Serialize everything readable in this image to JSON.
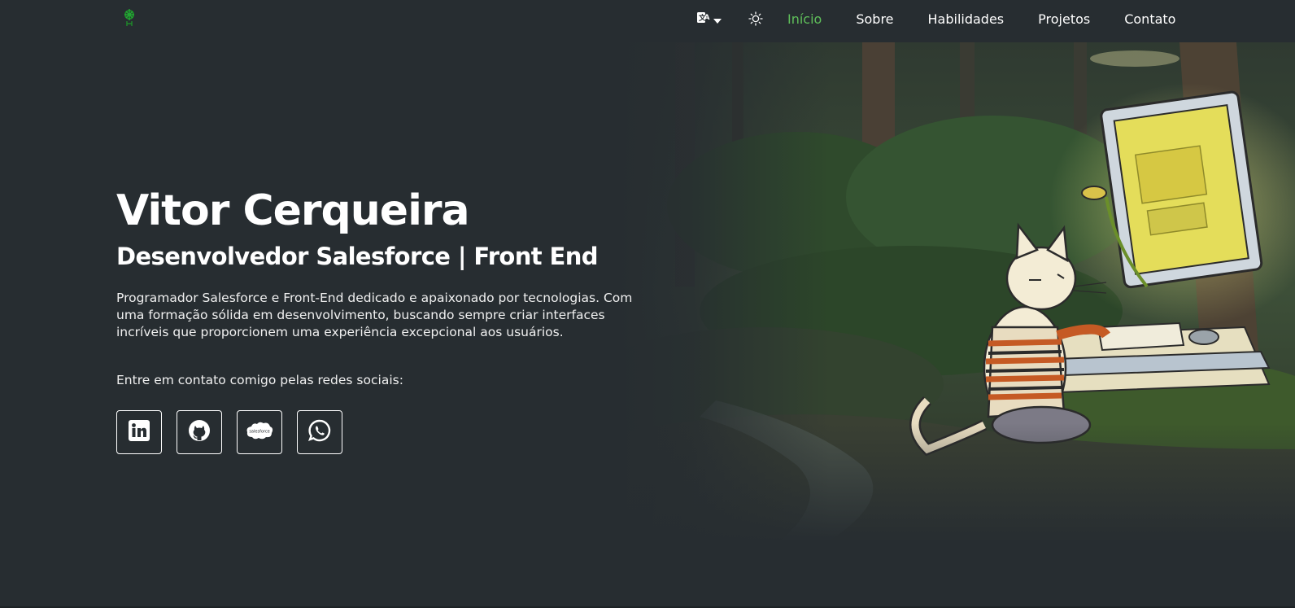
{
  "nav": {
    "language_icon": "translate-icon",
    "theme_icon": "sun-icon",
    "items": [
      {
        "label": "Início",
        "active": true
      },
      {
        "label": "Sobre",
        "active": false
      },
      {
        "label": "Habilidades",
        "active": false
      },
      {
        "label": "Projetos",
        "active": false
      },
      {
        "label": "Contato",
        "active": false
      }
    ]
  },
  "hero": {
    "name": "Vitor Cerqueira",
    "role": "Desenvolvedor Salesforce | Front End",
    "description": "Programador Salesforce e Front-End dedicado e apaixonado por tecnologias. Com uma formação sólida em desenvolvimento, buscando sempre criar interfaces incríveis que proporcionem uma experiência excepcional aos usuários.",
    "contact_prompt": "Entre em contato comigo pelas redes sociais:",
    "socials": [
      {
        "name": "linkedin-icon"
      },
      {
        "name": "github-icon"
      },
      {
        "name": "salesforce-icon",
        "label": "salesforce"
      },
      {
        "name": "whatsapp-icon"
      }
    ]
  },
  "colors": {
    "background": "#272d31",
    "accent": "#5fbf5a",
    "text": "#ffffff"
  }
}
